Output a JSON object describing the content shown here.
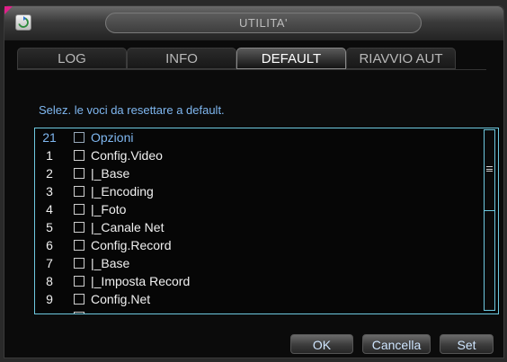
{
  "window": {
    "title": "UTILITA'"
  },
  "icons": {
    "app": "refresh-icon"
  },
  "tabs": [
    {
      "label": "LOG",
      "active": false
    },
    {
      "label": "INFO",
      "active": false
    },
    {
      "label": "DEFAULT",
      "active": true
    },
    {
      "label": "RIAVVIO AUT",
      "active": false
    }
  ],
  "instructions": "Selez. le voci da resettare a default.",
  "list": {
    "header": {
      "num": "21",
      "label": "Opzioni",
      "checked": false
    },
    "items": [
      {
        "num": "1",
        "label": "Config.Video",
        "checked": false
      },
      {
        "num": "2",
        "label": "|_Base",
        "checked": false
      },
      {
        "num": "3",
        "label": "|_Encoding",
        "checked": false
      },
      {
        "num": "4",
        "label": "|_Foto",
        "checked": false
      },
      {
        "num": "5",
        "label": "|_Canale Net",
        "checked": false
      },
      {
        "num": "6",
        "label": "Config.Record",
        "checked": false
      },
      {
        "num": "7",
        "label": "|_Base",
        "checked": false
      },
      {
        "num": "8",
        "label": "|_Imposta Record",
        "checked": false
      },
      {
        "num": "9",
        "label": "Config.Net",
        "checked": false
      }
    ]
  },
  "buttons": {
    "ok": "OK",
    "cancel": "Cancella",
    "set": "Set"
  },
  "colors": {
    "accent_text": "#7fb7f0",
    "list_border": "#6ec9e0",
    "title_bar_corner": "#e0208a"
  }
}
